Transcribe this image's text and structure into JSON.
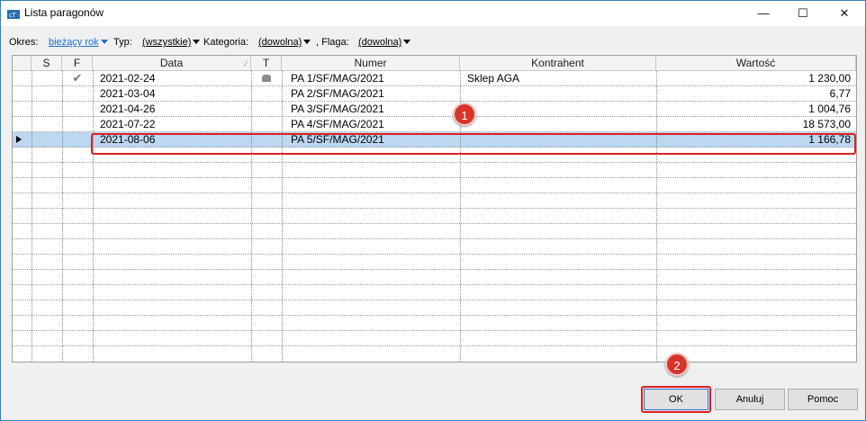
{
  "window": {
    "title": "Lista paragonów",
    "controls": {
      "minimize": "—",
      "maximize": "☐",
      "close": "✕"
    }
  },
  "filters": {
    "okres_label": "Okres:",
    "okres_value": "bieżący rok",
    "typ_label": "Typ:",
    "typ_value": "(wszystkie)",
    "kategoria_label": "Kategoria:",
    "kategoria_value": "(dowolna)",
    "flaga_label": ", Flaga:",
    "flaga_value": "(dowolna)"
  },
  "grid": {
    "columns": [
      "S",
      "F",
      "Data",
      "T",
      "Numer",
      "Kontrahent",
      "Wartość"
    ],
    "rows": [
      {
        "s": "",
        "f": "✔",
        "data": "2021-02-24",
        "t": "icon",
        "numer": "PA 1/SF/MAG/2021",
        "kontrahent": "Sklep AGA",
        "wartosc": "1 230,00"
      },
      {
        "s": "",
        "f": "",
        "data": "2021-03-04",
        "t": "",
        "numer": "PA 2/SF/MAG/2021",
        "kontrahent": "",
        "wartosc": "6,77"
      },
      {
        "s": "",
        "f": "",
        "data": "2021-04-26",
        "t": "",
        "numer": "PA 3/SF/MAG/2021",
        "kontrahent": "",
        "wartosc": "1 004,76"
      },
      {
        "s": "",
        "f": "",
        "data": "2021-07-22",
        "t": "",
        "numer": "PA 4/SF/MAG/2021",
        "kontrahent": "",
        "wartosc": "18 573,00"
      },
      {
        "s": "",
        "f": "",
        "data": "2021-08-06",
        "t": "",
        "numer": "PA 5/SF/MAG/2021",
        "kontrahent": "",
        "wartosc": "1 166,78"
      }
    ],
    "selected_row": 5,
    "empty_rows": 13
  },
  "annotations": {
    "badge1": "1",
    "badge2": "2"
  },
  "buttons": {
    "ok": "OK",
    "anuluj": "Anuluj",
    "pomoc": "Pomoc"
  },
  "colors": {
    "selection": "#bcd7f0",
    "callout": "#e02020",
    "badge": "#d8342c",
    "link": "#1a6fd0"
  }
}
